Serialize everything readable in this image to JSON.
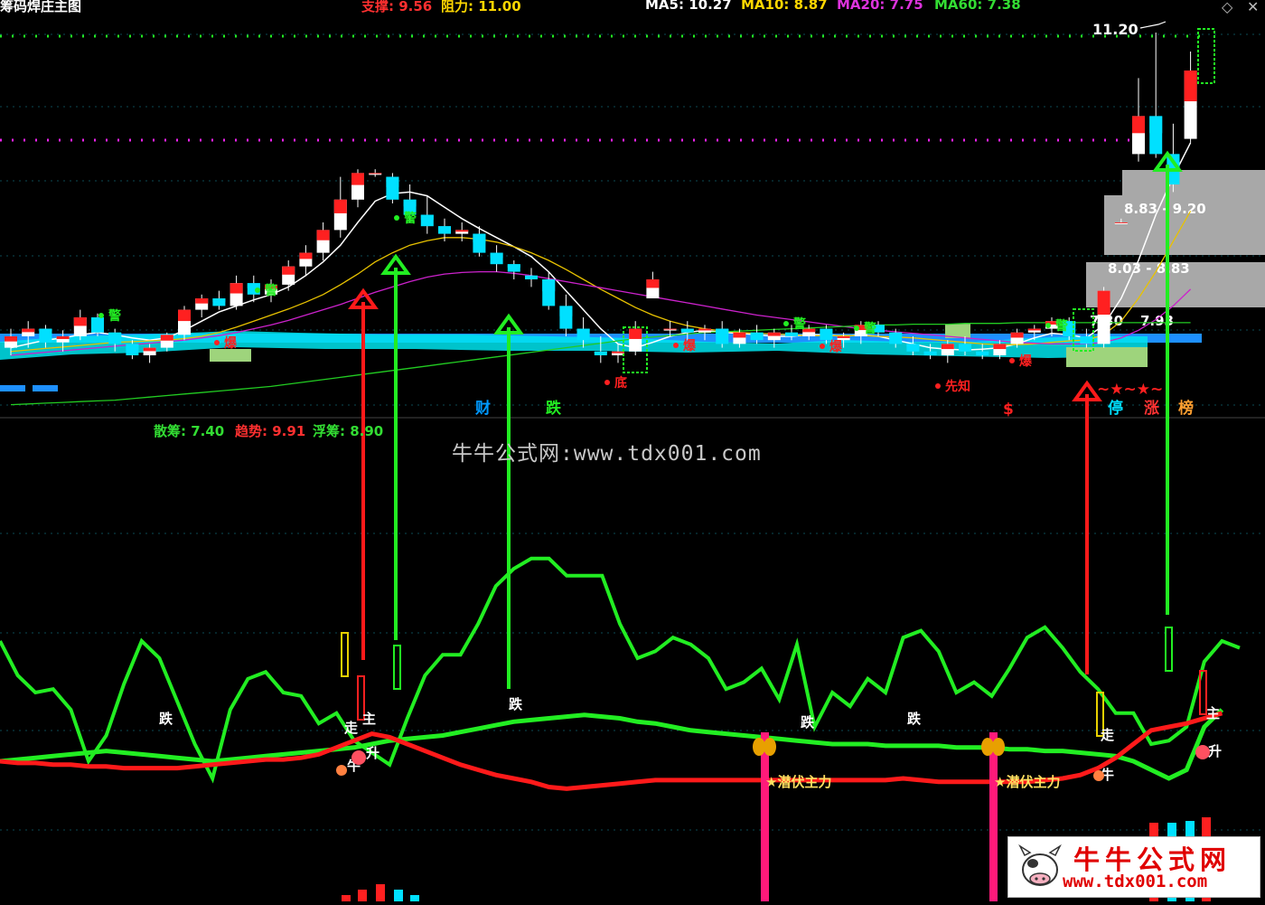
{
  "header": {
    "title": "筹码焊庄主图",
    "support_label": "支撑: 9.56",
    "resist_label": "阻力: 11.00",
    "ma5": "MA5: 10.27",
    "ma10": "MA10: 8.87",
    "ma20": "MA20: 7.75",
    "ma60": "MA60: 7.38",
    "corner_left": "◇",
    "corner_right": "✕"
  },
  "sub_header": {
    "sanchou": "散筹: 7.40",
    "qushi": "趋势: 9.91",
    "fuchou": "浮筹: 8.90"
  },
  "watermark": "牛牛公式网:www.tdx001.com",
  "logo": {
    "title": "牛牛公式网",
    "url": "www.tdx001.com"
  },
  "colors": {
    "up": "#ff2020",
    "down": "#00e0ff",
    "ma5": "#ffffff",
    "ma10": "#e8c200",
    "ma20": "#cc22cc",
    "ma60": "#22cc22",
    "arrow_up": "#ff1a1a",
    "arrow_green": "#22ee22",
    "band": "#00e5ee",
    "chips": "#1e90ff"
  },
  "chart_data": [
    {
      "type": "candlestick",
      "title": "筹码焊庄主图",
      "candles": [
        {
          "o": 7.05,
          "h": 7.3,
          "l": 6.95,
          "c": 7.2
        },
        {
          "o": 7.2,
          "h": 7.4,
          "l": 7.05,
          "c": 7.3
        },
        {
          "o": 7.3,
          "h": 7.35,
          "l": 7.05,
          "c": 7.12
        },
        {
          "o": 7.12,
          "h": 7.28,
          "l": 7.0,
          "c": 7.2
        },
        {
          "o": 7.2,
          "h": 7.55,
          "l": 7.15,
          "c": 7.45
        },
        {
          "o": 7.45,
          "h": 7.5,
          "l": 7.2,
          "c": 7.25
        },
        {
          "o": 7.25,
          "h": 7.3,
          "l": 7.0,
          "c": 7.1
        },
        {
          "o": 7.1,
          "h": 7.15,
          "l": 6.9,
          "c": 6.95
        },
        {
          "o": 6.95,
          "h": 7.1,
          "l": 6.85,
          "c": 7.05
        },
        {
          "o": 7.05,
          "h": 7.25,
          "l": 7.0,
          "c": 7.22
        },
        {
          "o": 7.22,
          "h": 7.6,
          "l": 7.15,
          "c": 7.55
        },
        {
          "o": 7.55,
          "h": 7.75,
          "l": 7.45,
          "c": 7.7
        },
        {
          "o": 7.7,
          "h": 7.8,
          "l": 7.55,
          "c": 7.6
        },
        {
          "o": 7.6,
          "h": 8.0,
          "l": 7.55,
          "c": 7.9
        },
        {
          "o": 7.9,
          "h": 8.0,
          "l": 7.65,
          "c": 7.75
        },
        {
          "o": 7.75,
          "h": 7.95,
          "l": 7.65,
          "c": 7.88
        },
        {
          "o": 7.88,
          "h": 8.2,
          "l": 7.8,
          "c": 8.12
        },
        {
          "o": 8.12,
          "h": 8.4,
          "l": 8.0,
          "c": 8.3
        },
        {
          "o": 8.3,
          "h": 8.7,
          "l": 8.2,
          "c": 8.6
        },
        {
          "o": 8.6,
          "h": 9.3,
          "l": 8.5,
          "c": 9.0
        },
        {
          "o": 9.0,
          "h": 9.4,
          "l": 8.9,
          "c": 9.35
        },
        {
          "o": 9.35,
          "h": 9.4,
          "l": 9.3,
          "c": 9.35
        },
        {
          "o": 9.3,
          "h": 9.35,
          "l": 8.95,
          "c": 9.0
        },
        {
          "o": 9.0,
          "h": 9.2,
          "l": 8.7,
          "c": 8.8
        },
        {
          "o": 8.8,
          "h": 9.05,
          "l": 8.55,
          "c": 8.65
        },
        {
          "o": 8.65,
          "h": 8.75,
          "l": 8.45,
          "c": 8.55
        },
        {
          "o": 8.55,
          "h": 8.7,
          "l": 8.45,
          "c": 8.6
        },
        {
          "o": 8.55,
          "h": 8.65,
          "l": 8.25,
          "c": 8.3
        },
        {
          "o": 8.3,
          "h": 8.4,
          "l": 8.05,
          "c": 8.15
        },
        {
          "o": 8.15,
          "h": 8.2,
          "l": 7.95,
          "c": 8.05
        },
        {
          "o": 8.0,
          "h": 8.1,
          "l": 7.85,
          "c": 7.95
        },
        {
          "o": 7.95,
          "h": 8.05,
          "l": 7.55,
          "c": 7.6
        },
        {
          "o": 7.6,
          "h": 7.75,
          "l": 7.2,
          "c": 7.3
        },
        {
          "o": 7.3,
          "h": 7.45,
          "l": 7.05,
          "c": 7.15
        },
        {
          "o": 7.0,
          "h": 7.2,
          "l": 6.85,
          "c": 6.95
        },
        {
          "o": 6.95,
          "h": 7.1,
          "l": 6.85,
          "c": 7.0
        },
        {
          "o": 7.0,
          "h": 7.4,
          "l": 6.95,
          "c": 7.3
        },
        {
          "o": 7.7,
          "h": 8.05,
          "l": 7.7,
          "c": 7.95
        },
        {
          "o": 7.3,
          "h": 7.4,
          "l": 7.2,
          "c": 7.3
        },
        {
          "o": 7.3,
          "h": 7.4,
          "l": 7.15,
          "c": 7.25
        },
        {
          "o": 7.25,
          "h": 7.35,
          "l": 7.15,
          "c": 7.3
        },
        {
          "o": 7.3,
          "h": 7.4,
          "l": 7.05,
          "c": 7.1
        },
        {
          "o": 7.1,
          "h": 7.3,
          "l": 7.05,
          "c": 7.25
        },
        {
          "o": 7.25,
          "h": 7.35,
          "l": 7.1,
          "c": 7.15
        },
        {
          "o": 7.15,
          "h": 7.3,
          "l": 7.05,
          "c": 7.25
        },
        {
          "o": 7.25,
          "h": 7.35,
          "l": 7.15,
          "c": 7.2
        },
        {
          "o": 7.2,
          "h": 7.35,
          "l": 7.15,
          "c": 7.3
        },
        {
          "o": 7.3,
          "h": 7.35,
          "l": 7.1,
          "c": 7.15
        },
        {
          "o": 7.15,
          "h": 7.25,
          "l": 7.05,
          "c": 7.2
        },
        {
          "o": 7.2,
          "h": 7.4,
          "l": 7.1,
          "c": 7.35
        },
        {
          "o": 7.35,
          "h": 7.4,
          "l": 7.2,
          "c": 7.25
        },
        {
          "o": 7.25,
          "h": 7.3,
          "l": 7.05,
          "c": 7.1
        },
        {
          "o": 7.1,
          "h": 7.2,
          "l": 6.95,
          "c": 7.0
        },
        {
          "o": 7.0,
          "h": 7.1,
          "l": 6.9,
          "c": 6.95
        },
        {
          "o": 6.95,
          "h": 7.15,
          "l": 6.85,
          "c": 7.1
        },
        {
          "o": 7.1,
          "h": 7.2,
          "l": 6.95,
          "c": 7.0
        },
        {
          "o": 7.0,
          "h": 7.1,
          "l": 6.9,
          "c": 6.95
        },
        {
          "o": 6.95,
          "h": 7.15,
          "l": 6.9,
          "c": 7.1
        },
        {
          "o": 7.1,
          "h": 7.3,
          "l": 7.05,
          "c": 7.25
        },
        {
          "o": 7.25,
          "h": 7.35,
          "l": 7.15,
          "c": 7.3
        },
        {
          "o": 7.3,
          "h": 7.45,
          "l": 7.2,
          "c": 7.4
        },
        {
          "o": 7.4,
          "h": 7.45,
          "l": 7.15,
          "c": 7.2
        },
        {
          "o": 7.2,
          "h": 7.3,
          "l": 7.05,
          "c": 7.1
        },
        {
          "o": 7.1,
          "h": 7.85,
          "l": 7.05,
          "c": 7.8
        },
        {
          "o": 8.7,
          "h": 8.75,
          "l": 8.7,
          "c": 8.7
        },
        {
          "o": 9.6,
          "h": 10.6,
          "l": 9.5,
          "c": 10.1
        },
        {
          "o": 10.1,
          "h": 11.2,
          "l": 9.55,
          "c": 9.6
        },
        {
          "o": 9.6,
          "h": 10.0,
          "l": 9.1,
          "c": 9.2
        },
        {
          "o": 9.8,
          "h": 10.95,
          "l": 9.75,
          "c": 10.7
        }
      ],
      "moving_averages": [
        {
          "name": "MA5",
          "values": [
            7.05,
            7.1,
            7.15,
            7.18,
            7.22,
            7.25,
            7.22,
            7.18,
            7.15,
            7.18,
            7.28,
            7.4,
            7.52,
            7.6,
            7.68,
            7.75,
            7.85,
            8.0,
            8.18,
            8.4,
            8.7,
            8.98,
            9.08,
            9.1,
            9.05,
            8.9,
            8.75,
            8.62,
            8.5,
            8.38,
            8.25,
            8.05,
            7.8,
            7.55,
            7.3,
            7.1,
            7.05,
            7.12,
            7.2,
            7.25,
            7.28,
            7.25,
            7.24,
            7.22,
            7.2,
            7.2,
            7.22,
            7.22,
            7.2,
            7.22,
            7.2,
            7.15,
            7.1,
            7.05,
            7.03,
            7.02,
            7.03,
            7.05,
            7.1,
            7.18,
            7.24,
            7.22,
            7.18,
            7.35,
            7.7,
            8.2,
            8.8,
            9.3,
            9.75
          ]
        },
        {
          "name": "MA10",
          "values": [
            7.0,
            7.02,
            7.04,
            7.06,
            7.08,
            7.1,
            7.12,
            7.13,
            7.14,
            7.15,
            7.17,
            7.2,
            7.25,
            7.32,
            7.4,
            7.48,
            7.56,
            7.65,
            7.75,
            7.88,
            8.02,
            8.18,
            8.3,
            8.4,
            8.46,
            8.5,
            8.5,
            8.48,
            8.44,
            8.38,
            8.3,
            8.2,
            8.08,
            7.95,
            7.82,
            7.7,
            7.58,
            7.48,
            7.4,
            7.34,
            7.3,
            7.27,
            7.25,
            7.24,
            7.23,
            7.22,
            7.21,
            7.21,
            7.21,
            7.21,
            7.2,
            7.19,
            7.18,
            7.16,
            7.14,
            7.12,
            7.1,
            7.09,
            7.09,
            7.1,
            7.12,
            7.14,
            7.15,
            7.22,
            7.4,
            7.7,
            8.05,
            8.45,
            8.85
          ]
        },
        {
          "name": "MA20",
          "values": [
            6.95,
            6.97,
            6.99,
            7.01,
            7.03,
            7.05,
            7.07,
            7.09,
            7.11,
            7.13,
            7.15,
            7.18,
            7.21,
            7.25,
            7.3,
            7.35,
            7.41,
            7.48,
            7.55,
            7.62,
            7.7,
            7.78,
            7.85,
            7.92,
            7.98,
            8.02,
            8.04,
            8.05,
            8.05,
            8.03,
            8.0,
            7.96,
            7.92,
            7.88,
            7.84,
            7.8,
            7.76,
            7.72,
            7.68,
            7.64,
            7.6,
            7.56,
            7.52,
            7.48,
            7.45,
            7.42,
            7.39,
            7.36,
            7.33,
            7.3,
            7.28,
            7.26,
            7.24,
            7.22,
            7.2,
            7.18,
            7.16,
            7.14,
            7.12,
            7.11,
            7.1,
            7.1,
            7.1,
            7.12,
            7.18,
            7.28,
            7.42,
            7.6,
            7.82
          ]
        },
        {
          "name": "MA60",
          "values": [
            6.3,
            6.31,
            6.32,
            6.33,
            6.34,
            6.35,
            6.36,
            6.38,
            6.4,
            6.42,
            6.44,
            6.46,
            6.48,
            6.5,
            6.52,
            6.54,
            6.57,
            6.6,
            6.63,
            6.66,
            6.69,
            6.72,
            6.75,
            6.78,
            6.81,
            6.84,
            6.87,
            6.9,
            6.93,
            6.96,
            6.99,
            7.02,
            7.05,
            7.08,
            7.11,
            7.14,
            7.17,
            7.19,
            7.21,
            7.23,
            7.25,
            7.26,
            7.27,
            7.28,
            7.29,
            7.3,
            7.31,
            7.32,
            7.33,
            7.34,
            7.35,
            7.35,
            7.36,
            7.36,
            7.36,
            7.37,
            7.37,
            7.37,
            7.38,
            7.38,
            7.38,
            7.38,
            7.38,
            7.38,
            7.38,
            7.38,
            7.38,
            7.38,
            7.38
          ]
        }
      ],
      "price_labels": [
        "11.20",
        "8.83 - 9.20",
        "8.03 - 8.83",
        "7.30",
        "7.93"
      ],
      "markers": [
        "警",
        "警",
        "警",
        "警",
        "警",
        "警",
        "爆",
        "爆",
        "爆",
        "爆",
        "底",
        "先知",
        "财",
        "跌",
        "$",
        "~★~★~",
        "停",
        "涨",
        "榜"
      ]
    },
    {
      "type": "line",
      "title": "",
      "series": [
        {
          "name": "散筹: 7.40",
          "values": [
            90,
            70,
            60,
            62,
            50,
            20,
            35,
            65,
            90,
            80,
            55,
            30,
            10,
            50,
            68,
            72,
            60,
            58,
            42,
            48,
            32,
            25,
            18,
            45,
            70,
            82,
            82,
            100,
            122,
            132,
            138,
            138,
            128,
            128,
            128,
            100,
            80,
            84,
            92,
            88,
            80,
            62,
            66,
            74,
            56,
            88,
            40,
            60,
            52,
            68,
            60,
            92,
            96,
            84,
            60,
            66,
            58,
            74,
            92,
            98,
            86,
            72,
            62,
            48,
            48,
            30,
            32,
            40,
            78,
            90,
            86
          ]
        },
        {
          "name": "浮筹: 8.90",
          "values": [
            20,
            21,
            22,
            23,
            24,
            25,
            26,
            25,
            24,
            23,
            22,
            21,
            20,
            21,
            22,
            23,
            24,
            25,
            26,
            27,
            28,
            30,
            32,
            33,
            34,
            35,
            37,
            39,
            41,
            43,
            44,
            45,
            46,
            47,
            46,
            45,
            43,
            42,
            40,
            38,
            37,
            36,
            35,
            34,
            33,
            32,
            31,
            30,
            30,
            30,
            29,
            29,
            29,
            29,
            28,
            28,
            28,
            27,
            27,
            26,
            26,
            25,
            24,
            23,
            20,
            15,
            10,
            15,
            40,
            50
          ]
        },
        {
          "name": "趋势: 9.91",
          "values": [
            20,
            19,
            19,
            18,
            18,
            17,
            17,
            16,
            16,
            16,
            16,
            17,
            18,
            19,
            20,
            21,
            21,
            22,
            24,
            28,
            32,
            36,
            34,
            30,
            26,
            22,
            18,
            15,
            12,
            10,
            8,
            5,
            4,
            5,
            6,
            7,
            8,
            9,
            9,
            9,
            9,
            9,
            9,
            9,
            9,
            9,
            9,
            9,
            9,
            9,
            9,
            10,
            9,
            8,
            8,
            8,
            8,
            8,
            8,
            9,
            10,
            12,
            16,
            22,
            30,
            38,
            40,
            42,
            45,
            48
          ]
        }
      ],
      "labels": [
        "跌",
        "走",
        "主",
        "牛",
        "升",
        "跌",
        "跌",
        "跌",
        "★潜伏主力",
        "★潜伏主力",
        "走",
        "牛",
        "主",
        "升"
      ]
    }
  ]
}
